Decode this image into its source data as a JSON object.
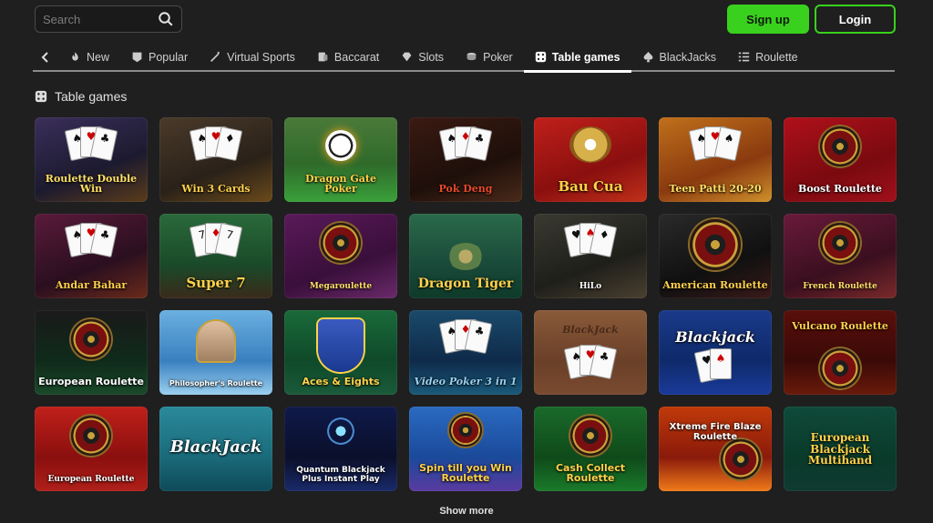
{
  "search": {
    "placeholder": "Search"
  },
  "auth": {
    "signup_label": "Sign up",
    "login_label": "Login"
  },
  "tabs": [
    {
      "label": "New",
      "icon": "flame-icon"
    },
    {
      "label": "Popular",
      "icon": "badge-icon"
    },
    {
      "label": "Virtual Sports",
      "icon": "wand-icon"
    },
    {
      "label": "Baccarat",
      "icon": "card-icon"
    },
    {
      "label": "Slots",
      "icon": "gem-icon"
    },
    {
      "label": "Poker",
      "icon": "chips-icon"
    },
    {
      "label": "Table games",
      "icon": "dice-icon",
      "active": true
    },
    {
      "label": "BlackJacks",
      "icon": "spade-icon"
    },
    {
      "label": "Roulette",
      "icon": "list-icon"
    }
  ],
  "section": {
    "title": "Table games"
  },
  "games": [
    {
      "title": "Roulette Double Win"
    },
    {
      "title": "Win 3 Cards"
    },
    {
      "title": "Dragon Gate Poker"
    },
    {
      "title": "Pok Deng"
    },
    {
      "title": "Bau Cua"
    },
    {
      "title": "Teen Patti 20-20"
    },
    {
      "title": "Boost Roulette"
    },
    {
      "title": "Andar Bahar"
    },
    {
      "title": "Super 7"
    },
    {
      "title": "Megaroulette"
    },
    {
      "title": "Dragon Tiger"
    },
    {
      "title": "HiLo"
    },
    {
      "title": "American Roulette"
    },
    {
      "title": "French Roulette"
    },
    {
      "title": "European Roulette"
    },
    {
      "title": "Philosopher's Roulette"
    },
    {
      "title": "Aces & Eights"
    },
    {
      "title": "Video Poker 3 in 1"
    },
    {
      "title": "BlackJack"
    },
    {
      "title": "Blackjack"
    },
    {
      "title": "Vulcano Roulette"
    },
    {
      "title": "European Roulette"
    },
    {
      "title": "BlackJack"
    },
    {
      "title": "Quantum Blackjack Plus Instant Play"
    },
    {
      "title": "Spin till you Win Roulette"
    },
    {
      "title": "Cash Collect Roulette"
    },
    {
      "title": "Xtreme Fire Blaze Roulette"
    },
    {
      "title": "European Blackjack Multihand"
    }
  ],
  "show_more_label": "Show more",
  "colors": {
    "accent": "#39d11d",
    "background": "#1f1f1f"
  }
}
